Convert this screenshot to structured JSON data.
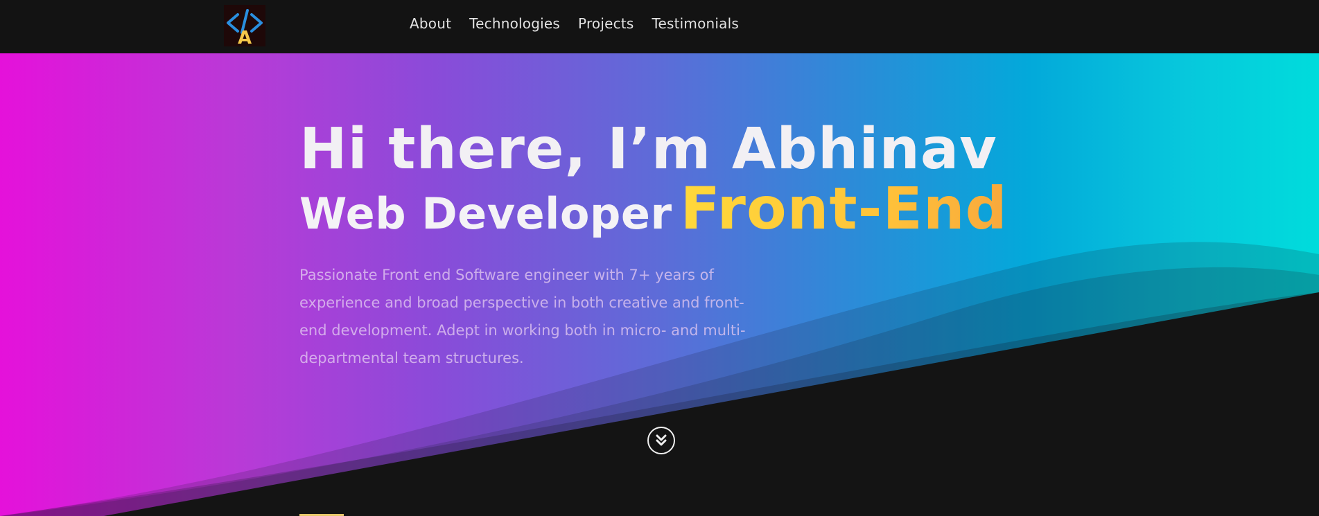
{
  "header": {
    "logo": {
      "icon": "code-brackets-icon",
      "letter": "A",
      "bracket_color": "#2a8fe0",
      "letter_color": "#f5c84a"
    },
    "nav": [
      {
        "label": "About"
      },
      {
        "label": "Technologies"
      },
      {
        "label": "Projects"
      },
      {
        "label": "Testimonials"
      }
    ]
  },
  "hero": {
    "title": "Hi there, I’m Abhinav",
    "role_prefix": "Web Developer",
    "role_highlight": "Front-End",
    "description": "Passionate Front end Software engineer with 7+ years of experience and broad perspective in both creative and front-end development. Adept in working both in micro- and multi-departmental team structures.",
    "scroll_icon": "double-chevron-down-icon"
  },
  "colors": {
    "background": "#141414",
    "gradient": [
      "#e511da",
      "#8a4bd9",
      "#03a9da",
      "#00dcdc"
    ],
    "accent": "#ffc43a"
  }
}
